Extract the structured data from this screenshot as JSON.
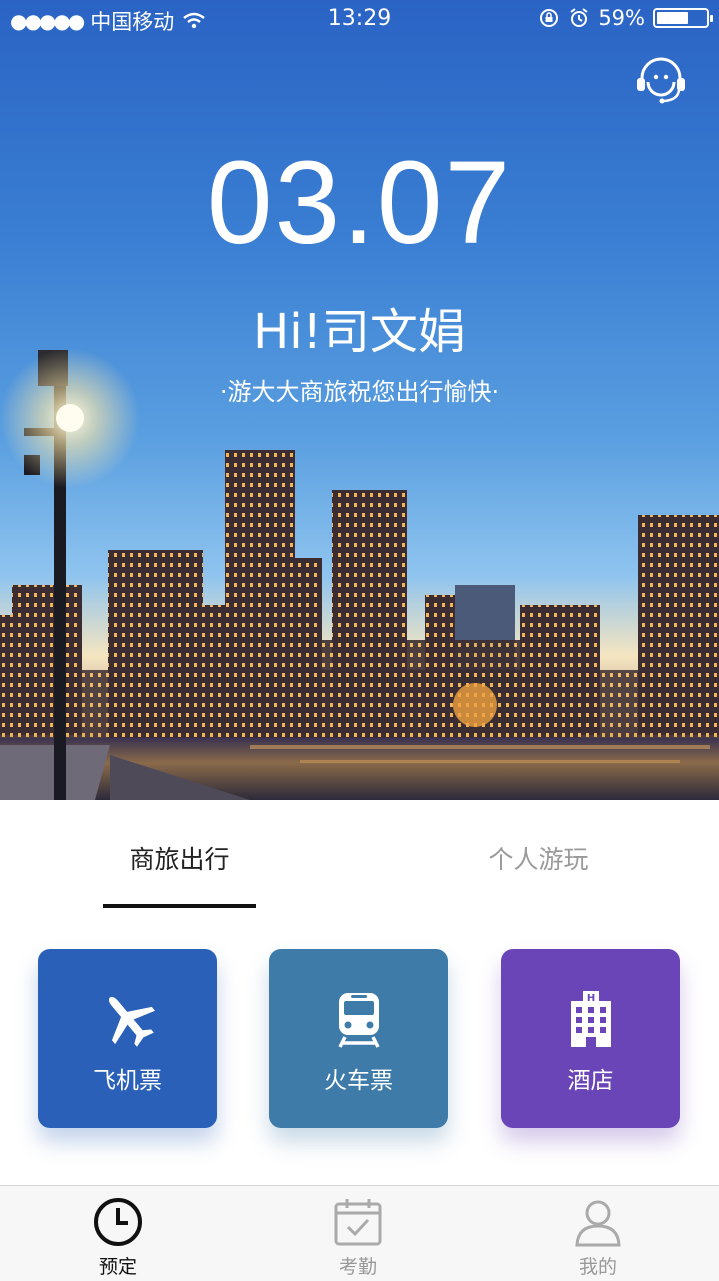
{
  "status_bar": {
    "signal_dots": "●●●●●",
    "carrier": "中国移动",
    "time": "13:29",
    "battery": "59%",
    "battery_level": 0.59
  },
  "hero": {
    "date": "03.07",
    "greeting": "Hi!司文娟",
    "slogan": "·游大大商旅祝您出行愉快·",
    "support_icon": "customer-service-headset-icon"
  },
  "tabs": [
    {
      "label": "商旅出行",
      "active": true
    },
    {
      "label": "个人游玩",
      "active": false
    }
  ],
  "services": [
    {
      "label": "飞机票",
      "icon": "airplane-icon",
      "color": "#2a60b8"
    },
    {
      "label": "火车票",
      "icon": "train-icon",
      "color": "#3f7ba8"
    },
    {
      "label": "酒店",
      "icon": "hotel-icon",
      "color": "#6a45b8"
    }
  ],
  "tabbar": [
    {
      "label": "预定",
      "icon": "clock-icon",
      "active": true
    },
    {
      "label": "考勤",
      "icon": "calendar-check-icon",
      "active": false
    },
    {
      "label": "我的",
      "icon": "person-icon",
      "active": false
    }
  ]
}
